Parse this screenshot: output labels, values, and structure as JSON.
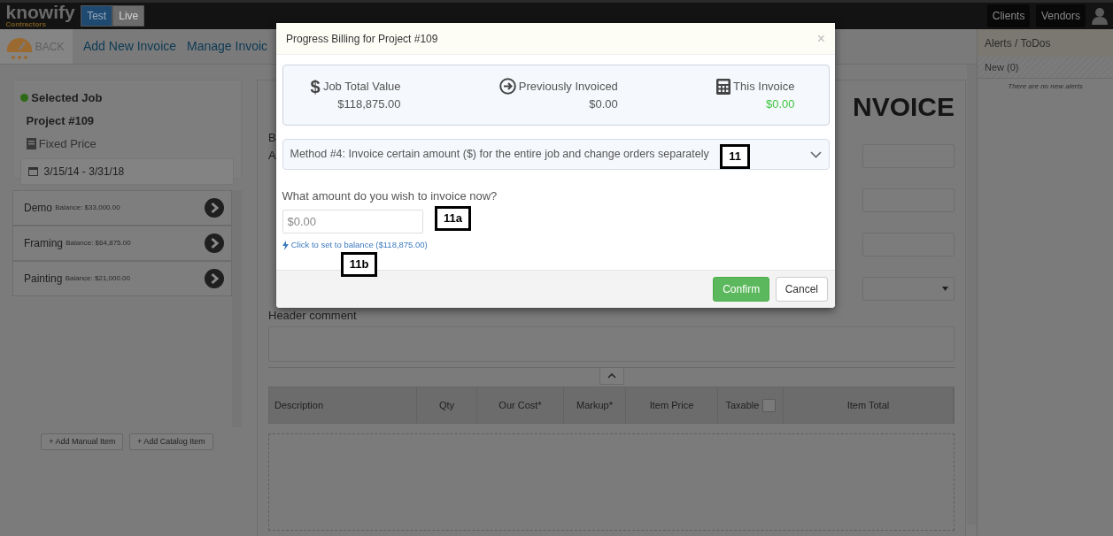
{
  "navbar": {
    "logo": "knowify",
    "logo_sub": "Contractors",
    "env_toggle": [
      {
        "label": "Test",
        "selected": true
      },
      {
        "label": "Live",
        "selected": false
      }
    ],
    "links": [
      "Clients",
      "Vendors"
    ]
  },
  "subnav": {
    "back": "BACK",
    "links": [
      "Add New Invoice",
      "Manage Invoic"
    ]
  },
  "job_panel": {
    "heading": "Selected Job",
    "project": "Project #109",
    "pricing": "Fixed Price",
    "dates": "3/15/14 - 3/31/18"
  },
  "phases": [
    {
      "name": "Demo",
      "balance": "Balance: $33,000.00"
    },
    {
      "name": "Framing",
      "balance": "Balance: $64,875.00"
    },
    {
      "name": "Painting",
      "balance": "Balance: $21,000.00"
    }
  ],
  "item_buttons": [
    "+ Add Manual Item",
    "+ Add Catalog Item"
  ],
  "invoice": {
    "title": "NVOICE",
    "labels": [
      "B",
      "A"
    ],
    "header_comment_label": "Header comment",
    "columns": [
      "Description",
      "Qty",
      "Our Cost*",
      "Markup*",
      "Item Price",
      "Taxable",
      "Item Total"
    ],
    "taxable_checked": false
  },
  "alerts": {
    "title": "Alerts / ToDos",
    "tab": "New (0)",
    "empty": "There are no new alerts"
  },
  "modal": {
    "title": "Progress Billing for Project #109",
    "close": "×",
    "stats": [
      {
        "kind": "dollar",
        "icon": "$",
        "label": "Job Total Value",
        "value": "$118,875.00"
      },
      {
        "kind": "arrow",
        "label": "Previously Invoiced",
        "value": "$0.00"
      },
      {
        "kind": "calculator",
        "label": "This Invoice",
        "value": "$0.00"
      }
    ],
    "method": "Method #4: Invoice certain amount ($) for the entire job and change orders separately",
    "question": "What amount do you wish to invoice now?",
    "amount_placeholder": "$0.00",
    "balance_link": "Click to set to balance ($118,875.00)",
    "buttons": [
      {
        "kind": "confirm",
        "label": "Confirm"
      },
      {
        "kind": "cancel",
        "label": "Cancel"
      }
    ]
  },
  "callouts": [
    "11",
    "11a",
    "11b"
  ]
}
